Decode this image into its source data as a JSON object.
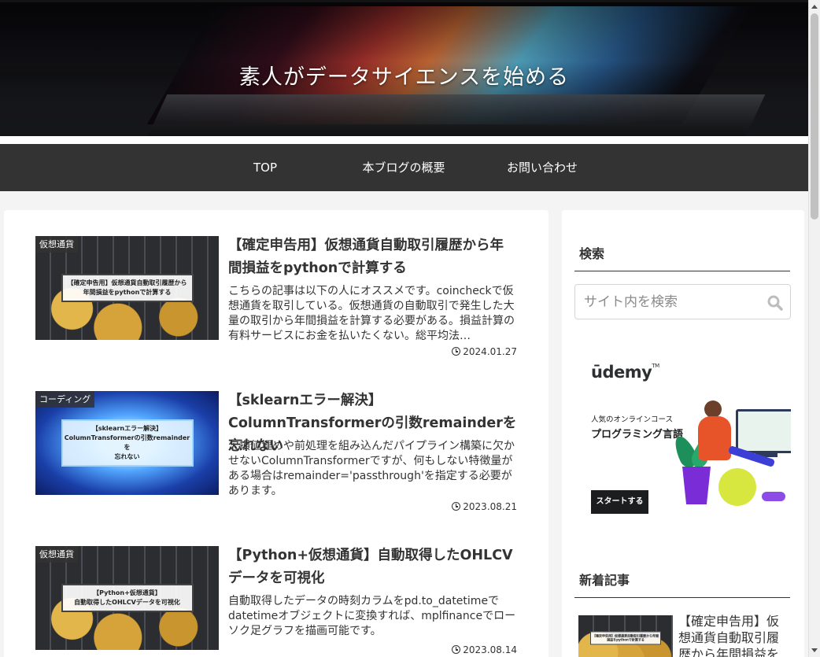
{
  "site": {
    "title": "素人がデータサイエンスを始める"
  },
  "nav": {
    "items": [
      {
        "label": "TOP"
      },
      {
        "label": "本ブログの概要"
      },
      {
        "label": "お問い合わせ"
      }
    ]
  },
  "posts": [
    {
      "category": "仮想通貨",
      "title": "【確定申告用】仮想通貨自動取引履歴から年間損益をpythonで計算する",
      "snippet": "こちらの記事は以下の人にオススメです。coincheckで仮想通貨を取引している。仮想通貨の自動取引で発生した大量の取引から年間損益を計算する必要がある。損益計算の有料サービスにお金を払いたくない。総平均法…",
      "date": "2024.01.27",
      "thumb_caption_line1": "【確定申告用】仮想通貨自動取引履歴から",
      "thumb_caption_line2": "年間損益をpythonで計算する"
    },
    {
      "category": "コーディング",
      "title": "【sklearnエラー解決】ColumnTransformerの引数remainderを忘れない",
      "snippet": "欠損値埋めや前処理を組み込んだパイプライン構築に欠かせないColumnTransformerですが、何もしない特徴量がある場合はremainder='passthrough'を指定する必要があります。",
      "date": "2023.08.21",
      "thumb_caption_line1": "【sklearnエラー解決】",
      "thumb_caption_line2": "ColumnTransformerの引数remainderを",
      "thumb_caption_line3": "忘れない"
    },
    {
      "category": "仮想通貨",
      "title": "【Python+仮想通貨】自動取得したOHLCVデータを可視化",
      "snippet": "自動取得したデータの時刻カラムをpd.to_datetimeでdatetimeオブジェクトに変換すれば、mplfinanceでローソク足グラフを描画可能です。",
      "date": "2023.08.14",
      "thumb_caption_line1": "【Python+仮想通貨】",
      "thumb_caption_line2": "自動取得したOHLCVデータを可視化"
    }
  ],
  "sidebar": {
    "search_title": "検索",
    "search_placeholder": "サイト内を検索",
    "new_posts_title": "新着記事",
    "ad": {
      "logo": "ūdemy",
      "logo_tm": "TM",
      "subtitle": "人気のオンラインコース",
      "headline": "プログラミング言語",
      "button": "スタートする"
    },
    "new_post": {
      "title": "【確定申告用】仮想通貨自動取引履歴から年間損益を",
      "thumb_caption": "【確定申告用】仮想通貨自動取引履歴から年間損益をpythonで計算する"
    }
  },
  "colors": {
    "nav_bg": "#333333",
    "page_bg": "#f4f4f4",
    "card_bg": "#ffffff",
    "text": "#333333"
  }
}
